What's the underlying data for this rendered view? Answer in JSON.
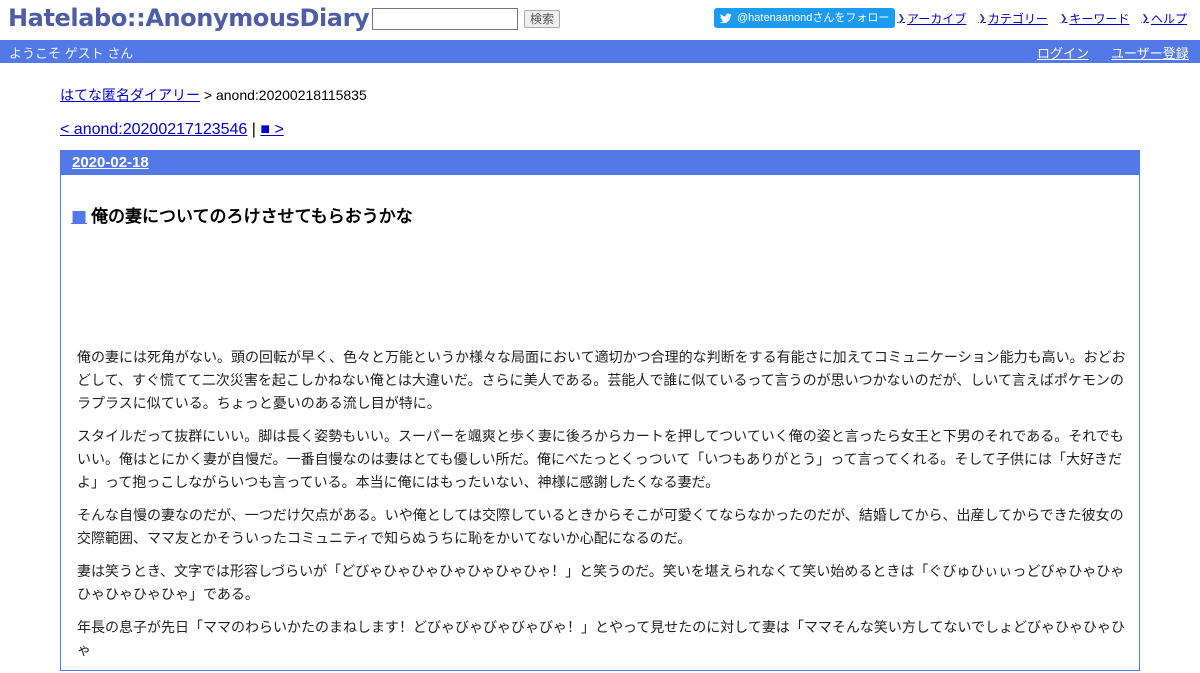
{
  "header": {
    "logo": "Hatelabo::AnonymousDiary",
    "search": {
      "value": "",
      "placeholder": ""
    },
    "search_button": "検索",
    "twitter_follow": "@hatenaanondさんをフォロー",
    "links": [
      "アーカイブ",
      "カテゴリー",
      "キーワード",
      "ヘルプ"
    ]
  },
  "bar": {
    "welcome": "ようこそ ゲスト さん",
    "login": "ログイン",
    "register": "ユーザー登録"
  },
  "breadcrumb": {
    "home": "はてな匿名ダイアリー",
    "sep": " > ",
    "current": "anond:20200218115835"
  },
  "pager": {
    "prev": "< anond:20200217123546",
    "sep": " | ",
    "next": "■ >"
  },
  "day": {
    "date": "2020-02-18",
    "title_mark": "■",
    "title": "俺の妻についてのろけさせてもらおうかな",
    "paragraphs": [
      "俺の妻には死角がない。頭の回転が早く、色々と万能というか様々な局面において適切かつ合理的な判断をする有能さに加えてコミュニケーション能力も高い。おどおどして、すぐ慌てて二次災害を起こしかねない俺とは大違いだ。さらに美人である。芸能人で誰に似ているって言うのが思いつかないのだが、しいて言えばポケモンのラプラスに似ている。ちょっと憂いのある流し目が特に。",
      "スタイルだって抜群にいい。脚は長く姿勢もいい。スーパーを颯爽と歩く妻に後ろからカートを押してついていく俺の姿と言ったら女王と下男のそれである。それでもいい。俺はとにかく妻が自慢だ。一番自慢なのは妻はとても優しい所だ。俺にべたっとくっついて「いつもありがとう」って言ってくれる。そして子供には「大好きだよ」って抱っこしながらいつも言っている。本当に俺にはもったいない、神様に感謝したくなる妻だ。",
      "そんな自慢の妻なのだが、一つだけ欠点がある。いや俺としては交際しているときからそこが可愛くてならなかったのだが、結婚してから、出産してからできた彼女の交際範囲、ママ友とかそういったコミュニティで知らぬうちに恥をかいてないか心配になるのだ。",
      "妻は笑うとき、文字では形容しづらいが「どびゃひゃひゃひゃひゃひゃひゃ！」と笑うのだ。笑いを堪えられなくて笑い始めるときは「ぐびゅひぃぃっどびゃひゃひゃひゃひゃひゃひゃ」である。",
      "年長の息子が先日「ママのわらいかたのまねします！どびゃびゃびゃびゃびゃ！」とやって見せたのに対して妻は「ママそんな笑い方してないでしょどびゃひゃひゃひゃ"
    ]
  }
}
